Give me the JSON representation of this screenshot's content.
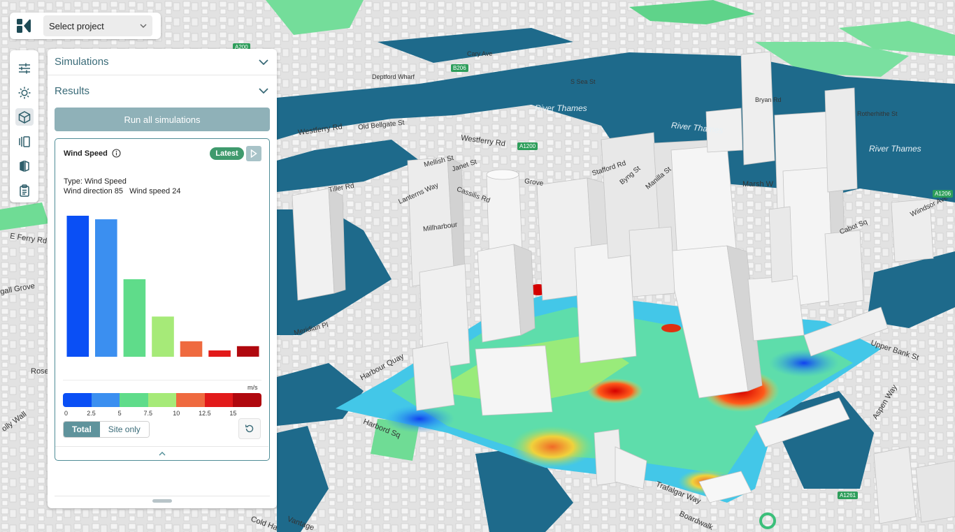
{
  "project_selector": {
    "placeholder": "Select project",
    "logo": "project-logo-icon"
  },
  "toolbar": {
    "items": [
      {
        "icon": "sliders-icon"
      },
      {
        "icon": "sun-icon"
      },
      {
        "icon": "cube-icon",
        "active": true
      },
      {
        "icon": "buildings-icon"
      },
      {
        "icon": "split-view-icon"
      },
      {
        "icon": "clipboard-icon"
      }
    ]
  },
  "panel": {
    "sections": [
      {
        "label": "Simulations"
      },
      {
        "label": "Results"
      }
    ],
    "run_all_label": "Run all simulations",
    "result_card": {
      "title": "Wind Speed",
      "status_badge": "Latest",
      "type_line": "Type: Wind Speed",
      "wind_direction": "Wind direction 85",
      "wind_speed": "Wind speed 24",
      "legend_unit": "m/s",
      "legend_ticks": [
        "0",
        "2.5",
        "5",
        "7.5",
        "10",
        "12.5",
        "15"
      ],
      "toggle": {
        "total": "Total",
        "site_only": "Site only",
        "selected": "Total"
      }
    }
  },
  "chart_data": {
    "type": "bar",
    "title": "",
    "categories": [
      "0-2.5",
      "2.5-5",
      "5-7.5",
      "7.5-10",
      "10-12.5",
      "12.5-15",
      "15+"
    ],
    "values": [
      100,
      97.5,
      55,
      28.5,
      11,
      4.5,
      7.5
    ],
    "colors": [
      "#0a4ff5",
      "#3b8ff0",
      "#5fdc8a",
      "#a6ea78",
      "#ef6a3f",
      "#e21a1a",
      "#b0080e"
    ],
    "ylim": [
      0,
      100
    ],
    "axis_labels_visible": false,
    "grid": false
  },
  "legend_colors": [
    "#0a4ff5",
    "#3b8ff0",
    "#5fdc8a",
    "#a6ea78",
    "#ef6a3f",
    "#e21a1a",
    "#b0080e"
  ],
  "map": {
    "labels": {
      "river_thames_1": "River Thames",
      "river_thames_2": "River Thames",
      "river_thames_3": "River Thames",
      "westferry_rd": "Westferry Rd",
      "westferry_rd_2": "Westferry Rd",
      "old_belgate": "Old Bellgate St",
      "deptford_wharf": "Deptford Wharf",
      "e_ferry_rd": "E Ferry Rd",
      "harbour_quay": "Harbour Quay",
      "harbord_sq": "Harbord Sq",
      "upper_bank_st": "Upper Bank St",
      "aspen_way": "Aspen Way",
      "trafalgar_way": "Trafalgar Way",
      "cold_harbour": "Cold Ha",
      "marsh_wall": "Marsh W",
      "bryan_rd": "Bryan Rd",
      "rotherhithe_st": "Rotherhithe St",
      "millharbour": "Millharbour",
      "lanterns_way": "Lanterns Way",
      "mellish_st": "Mellish St",
      "janet_st": "Janet St",
      "stafford_rd": "Stafford Rd",
      "byng_st": "Byng St",
      "manilla_st": "Manilla St",
      "cassilis_rd": "Cassilis Rd",
      "cabot_sq": "Cabot Sq",
      "westferry_cir": "Wiindsor Ave",
      "tiller_rd": "Tiller Rd",
      "meridian_pl": "Meridian Pl",
      "ollywall": "olly Wall",
      "rose": "Rose",
      "gall_grove": "gall Grove",
      "boardwalk": "Boardwalk",
      "vantage": "Vantage",
      "cary_ave": "Cary Ave",
      "surrey_quays": "S Sea St",
      "grove": "Grove"
    },
    "road_badges": [
      "A200",
      "B206",
      "A1200",
      "A1206",
      "A1261"
    ]
  }
}
